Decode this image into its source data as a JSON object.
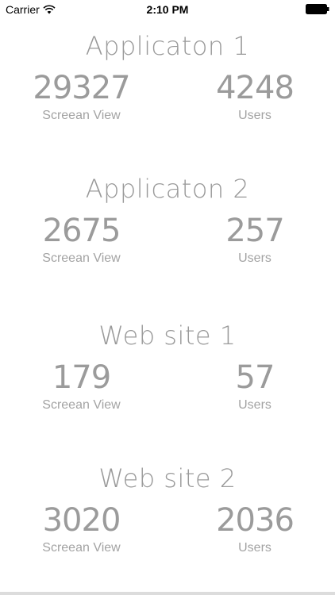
{
  "status_bar": {
    "carrier": "Carrier",
    "time": "2:10 PM"
  },
  "sections": [
    {
      "title": "Applicaton 1",
      "left": {
        "value": "29327",
        "label": "Screean View"
      },
      "right": {
        "value": "4248",
        "label": "Users"
      }
    },
    {
      "title": "Applicaton 2",
      "left": {
        "value": "2675",
        "label": "Screean View"
      },
      "right": {
        "value": "257",
        "label": "Users"
      }
    },
    {
      "title": "Web site 1",
      "left": {
        "value": "179",
        "label": "Screean View"
      },
      "right": {
        "value": "57",
        "label": "Users"
      }
    },
    {
      "title": "Web site 2",
      "left": {
        "value": "3020",
        "label": "Screean View"
      },
      "right": {
        "value": "2036",
        "label": "Users"
      }
    }
  ],
  "colors": {
    "text_gray": "#9a9a9a",
    "status_text": "#000000",
    "background": "#ffffff"
  },
  "icons": [
    "wifi-icon",
    "battery-icon"
  ]
}
